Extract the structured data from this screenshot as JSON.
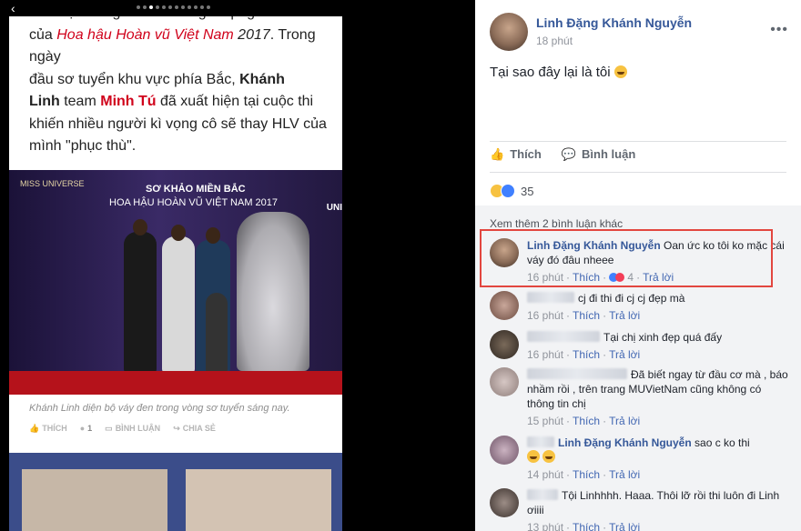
{
  "left": {
    "article": {
      "line1_prefix": "đã được đăng tải trên trang fanpage chính thức",
      "line2_prefix": "của ",
      "pageant_name": "Hoa hậu Hoàn vũ Việt Nam",
      "year": " 2017",
      "line2_suffix": ". Trong ngày",
      "line3": "đầu sơ tuyển khu vực phía Bắc, ",
      "khanh": "Khánh",
      "linh": "Linh",
      "team": " team ",
      "minh_tu": "Minh Tú",
      "line4_suffix": " đã xuất hiện tại cuộc thi",
      "line5": "khiến nhiều người kì vọng cô sẽ thay HLV của",
      "line6": "mình \"phục thù\"."
    },
    "photo": {
      "logo": "MISS UNIVERSE",
      "banner_title": "SƠ KHẢO MIỀN BẮC",
      "banner_sub": "HOA HẬU HOÀN VŨ VIỆT NAM 2017",
      "right_text": "UNI"
    },
    "caption": "Khánh Linh diện bộ váy đen trong vòng sơ tuyển sáng nay.",
    "actions": {
      "like": "THÍCH",
      "like_count": "1",
      "comment": "BÌNH LUẬN",
      "share": "CHIA SẺ"
    }
  },
  "post": {
    "author": "Linh Đặng Khánh Nguyễn",
    "time": "18 phút",
    "text": "Tại sao đây lại là tôi",
    "more_icon": "more-horizontal-icon",
    "like_label": "Thích",
    "comment_label": "Bình luận",
    "reaction_count": "35",
    "view_more": "Xem thêm 2 bình luận khác"
  },
  "comments": [
    {
      "author": "Linh Đặng Khánh Nguyễn",
      "text": "Oan ức ko tôi ko mặc cái váy đó đâu nheee",
      "time": "16 phút",
      "like": "Thích",
      "reactions": "4",
      "reply": "Trả lời"
    },
    {
      "author": "",
      "text": "cj đi thi đi cj cj đẹp mà",
      "time": "16 phút",
      "like": "Thích",
      "reply": "Trả lời"
    },
    {
      "author": "",
      "text": "Tại chị xinh đẹp quá đấy",
      "time": "16 phút",
      "like": "Thích",
      "reply": "Trả lời"
    },
    {
      "author": "",
      "text": "Đã biết ngay từ đầu cơ mà , báo nhầm rồi , trên trang MUVietNam cũng không có thông tin chị",
      "time": "15 phút",
      "like": "Thích",
      "reply": "Trả lời"
    },
    {
      "author": "",
      "tag": "Linh Đặng Khánh Nguyễn",
      "text": "sao c ko thi",
      "time": "14 phút",
      "like": "Thích",
      "reply": "Trả lời"
    },
    {
      "author": "",
      "text": "Tội Linhhhh. Haaa. Thôi lỡ rồi thi luôn đi Linh ơiiii",
      "time": "13 phút",
      "like": "Thích",
      "reply": "Trả lời"
    }
  ]
}
